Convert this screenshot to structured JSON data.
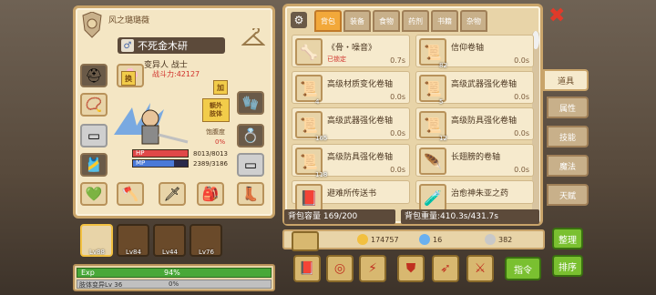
{
  "character": {
    "title_prefix": "风之璐璐薇",
    "name": "不死金木研",
    "gender": "♂",
    "race_class": "变异人 战士",
    "power_label": "战斗力:42127",
    "extra_body_label": "额外\n肢体",
    "fullness_label": "饱腹度",
    "fullness_value": "0%",
    "hp_label": "HP",
    "hp_value": "8013/8013",
    "mp_label": "MP",
    "mp_value": "2389/3186",
    "tag_swap": "换",
    "tag_add": "加"
  },
  "companions": [
    {
      "lv": "Lv88",
      "selected": true
    },
    {
      "lv": "Lv84",
      "selected": false
    },
    {
      "lv": "Lv44",
      "selected": false
    },
    {
      "lv": "Lv76",
      "selected": false
    }
  ],
  "exp": {
    "label": "Exp",
    "percent": "94%",
    "sub_label": "肢体变异Lv 36",
    "sub_percent": "0%"
  },
  "bag": {
    "tabs": [
      "背包",
      "装备",
      "食物",
      "药剂",
      "书籍",
      "杂物"
    ],
    "active_tab": 0,
    "items": [
      {
        "name": "《骨・噪音》",
        "locked": "已锁定",
        "time": "0.7s",
        "count": "",
        "icon": "🦴"
      },
      {
        "name": "信仰卷轴",
        "locked": "",
        "time": "0.0s",
        "count": "82",
        "icon": "📜"
      },
      {
        "name": "高级材质变化卷轴",
        "locked": "",
        "time": "0.0s",
        "count": "4",
        "icon": "📜"
      },
      {
        "name": "高级武器强化卷轴",
        "locked": "",
        "time": "0.0s",
        "count": "5",
        "icon": "📜"
      },
      {
        "name": "高级武器强化卷轴",
        "locked": "",
        "time": "0.0s",
        "count": "165",
        "icon": "📜"
      },
      {
        "name": "高级防具强化卷轴",
        "locked": "",
        "time": "0.0s",
        "count": "12",
        "icon": "📜"
      },
      {
        "name": "高级防具强化卷轴",
        "locked": "",
        "time": "0.0s",
        "count": "118",
        "icon": "📜"
      },
      {
        "name": "长翅膀的卷轴",
        "locked": "",
        "time": "0.0s",
        "count": "",
        "icon": "🪶"
      },
      {
        "name": "避难所传送书",
        "locked": "",
        "time": "",
        "count": "",
        "icon": "📕"
      },
      {
        "name": "治愈神朱亚之药",
        "locked": "",
        "time": "",
        "count": "",
        "icon": "🧪"
      }
    ],
    "capacity": "背包容量 169/200",
    "weight": "背包重量:410.3s/431.7s"
  },
  "side_tabs": [
    "道具",
    "属性",
    "技能",
    "魔法",
    "天赋"
  ],
  "active_side_tab": 0,
  "currency": {
    "gold": "174757",
    "gem": "16",
    "silver": "382"
  },
  "buttons": {
    "organize": "整理",
    "sort": "排序",
    "command": "指令"
  },
  "colors": {
    "hp": "#e04848",
    "mp": "#4a7ad8",
    "accent": "#f2a83a",
    "exp": "#48a838"
  }
}
